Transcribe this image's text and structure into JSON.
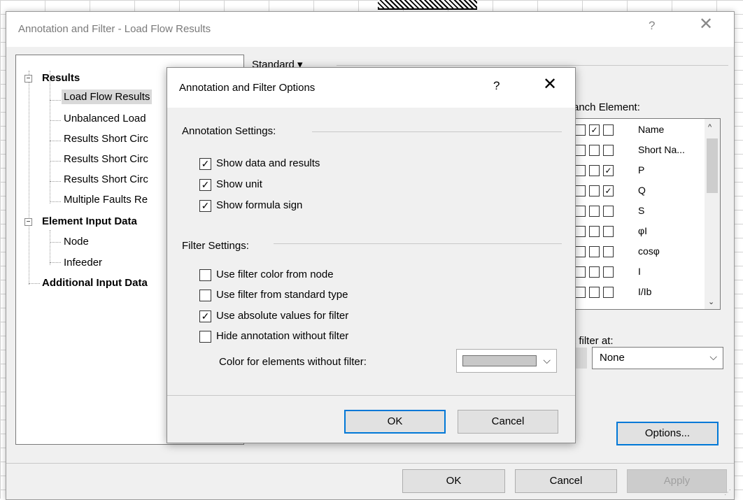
{
  "main_dialog": {
    "title": "Annotation and Filter - Load Flow Results",
    "help": "?",
    "close": "✕",
    "tree": [
      {
        "label": "Results",
        "bold": true,
        "expander": "−"
      },
      {
        "label": "Load Flow Results",
        "selected": true
      },
      {
        "label": "Unbalanced Load"
      },
      {
        "label": "Results Short Circ"
      },
      {
        "label": "Results Short Circ"
      },
      {
        "label": "Results Short Circ"
      },
      {
        "label": "Multiple Faults Re"
      },
      {
        "label": "Element Input Data",
        "bold": true,
        "expander": "−"
      },
      {
        "label": "Node"
      },
      {
        "label": "Infeeder"
      },
      {
        "label": "Additional Input Data",
        "bold": true
      }
    ],
    "standard_label": "Standard ▾",
    "branch_element_label": "anch Element:",
    "branch_list": [
      {
        "label": "Name",
        "checks": [
          false,
          true,
          false
        ]
      },
      {
        "label": "Short Na...",
        "checks": [
          false,
          false,
          false
        ]
      },
      {
        "label": "P",
        "checks": [
          false,
          false,
          true
        ]
      },
      {
        "label": "Q",
        "checks": [
          false,
          false,
          true
        ]
      },
      {
        "label": "S",
        "checks": [
          false,
          false,
          false
        ]
      },
      {
        "label": "φI",
        "checks": [
          false,
          false,
          false
        ]
      },
      {
        "label": "cosφ",
        "checks": [
          false,
          false,
          false
        ]
      },
      {
        "label": "I",
        "checks": [
          false,
          false,
          false
        ]
      },
      {
        "label": "I/Ib",
        "checks": [
          false,
          false,
          false
        ]
      }
    ],
    "filter_at_label": "t filter at:",
    "filter_select_value": "None",
    "options_button": "Options...",
    "ok": "OK",
    "cancel": "Cancel",
    "apply": "Apply"
  },
  "options_dialog": {
    "title": "Annotation and Filter Options",
    "help": "?",
    "close": "✕",
    "annotation_settings_label": "Annotation Settings:",
    "annotation_settings": [
      {
        "label": "Show data and results",
        "checked": true
      },
      {
        "label": "Show unit",
        "checked": true
      },
      {
        "label": "Show formula sign",
        "checked": true
      }
    ],
    "filter_settings_label": "Filter Settings:",
    "filter_settings": [
      {
        "label": "Use filter color from node",
        "checked": false
      },
      {
        "label": "Use filter from standard type",
        "checked": false
      },
      {
        "label": "Use absolute values for filter",
        "checked": true
      },
      {
        "label": "Hide annotation without filter",
        "checked": false
      }
    ],
    "color_label": "Color for elements without filter:",
    "color_value": "#c8c8c8",
    "ok": "OK",
    "cancel": "Cancel"
  },
  "icons": {
    "check": "✓",
    "chevron_down": "⌵",
    "scroll_up": "^",
    "scroll_down": "⌄"
  }
}
